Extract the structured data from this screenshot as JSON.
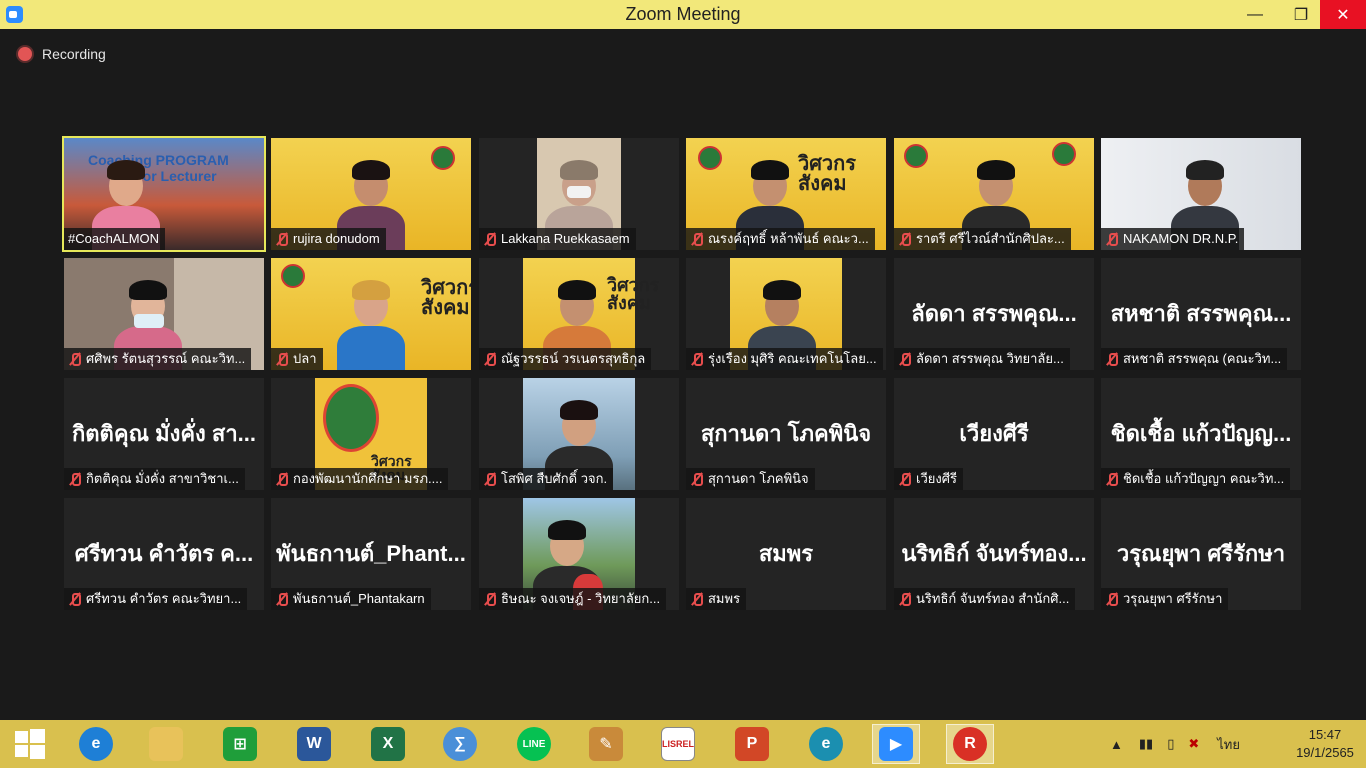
{
  "window": {
    "title": "Zoom Meeting"
  },
  "recording": {
    "label": "Recording"
  },
  "participants": [
    {
      "label": "#CoachALMON",
      "video": true,
      "active": true,
      "muted": false
    },
    {
      "label": "rujira donudom",
      "video": true,
      "muted": true
    },
    {
      "label": "Lakkana Ruekkasaem",
      "video": true,
      "muted": true
    },
    {
      "label": "ณรงค์ฤทธิ์ หล้าพันธ์ คณะว...",
      "video": true,
      "muted": true
    },
    {
      "label": "ราตรี   ศรีไวณ์สำนักศิปละ...",
      "video": true,
      "muted": true
    },
    {
      "label": "NAKAMON DR.N.P.",
      "video": true,
      "muted": true
    },
    {
      "label": "ศศิพร รัตนสุวรรณ์ คณะวิท...",
      "video": true,
      "muted": true
    },
    {
      "label": "ปลา",
      "video": true,
      "muted": true
    },
    {
      "label": "ณัฐวรรธน์ วรเนตรสุทธิกุล",
      "video": true,
      "muted": true
    },
    {
      "label": "รุ่งเรือง มุศิริ คณะเทคโนโลย...",
      "video": true,
      "muted": true
    },
    {
      "label": "ลัดดา สรรพคุณ  วิทยาลัย...",
      "big": "ลัดดา สรรพคุณ...",
      "video": false,
      "muted": true
    },
    {
      "label": "สหชาติ สรรพคุณ (คณะวิท...",
      "big": "สหชาติ สรรพคุณ...",
      "video": false,
      "muted": true
    },
    {
      "label": "กิตติคุณ  มั่งคั่ง สาขาวิชาเ...",
      "big": "กิตติคุณ  มั่งคั่ง สา...",
      "video": false,
      "muted": true
    },
    {
      "label": "กองพัฒนานักศึกษา มรภ....",
      "video": true,
      "muted": true
    },
    {
      "label": "โสพิศ สืบศักดิ์ วจก.",
      "video": true,
      "muted": true
    },
    {
      "label": "สุกานดา โภคพินิจ",
      "big": "สุกานดา โภคพินิจ",
      "video": false,
      "muted": true
    },
    {
      "label": "เวียงศีรี",
      "big": "เวียงศีรี",
      "video": false,
      "muted": true
    },
    {
      "label": "ชิดเชื้อ แก้วปัญญา คณะวิท...",
      "big": "ชิดเชื้อ แก้วปัญญ...",
      "video": false,
      "muted": true
    },
    {
      "label": "ศรีทวน  คำวัตร คณะวิทยา...",
      "big": "ศรีทวน  คำวัตร ค...",
      "video": false,
      "muted": true
    },
    {
      "label": "พันธกานต์_Phantakarn",
      "big": "พันธกานต์_Phant...",
      "video": false,
      "muted": true
    },
    {
      "label": "ธิษณะ จงเจษฎ์ - วิทยาลัยก...",
      "video": true,
      "muted": true
    },
    {
      "label": "สมพร",
      "big": "สมพร",
      "video": false,
      "muted": true
    },
    {
      "label": "นริทธิก์ จันทร์ทอง สำนักศิ...",
      "big": "นริทธิก์ จันทร์ทอง...",
      "video": false,
      "muted": true
    },
    {
      "label": "วรุณยุพา ศรีรักษา",
      "big": "วรุณยุพา ศรีรักษา",
      "video": false,
      "muted": true
    }
  ],
  "video_text": {
    "coach_banner": "Coaching PROGRAM",
    "coach_banner2": "for Lecturer",
    "banner_thai1": "วิศวกร",
    "banner_thai2": "สังคม"
  },
  "taskbar": {
    "apps": [
      {
        "name": "internet-explorer-icon",
        "glyph": "e",
        "color": "#1e7fd6"
      },
      {
        "name": "file-explorer-icon",
        "glyph": "",
        "color": "#e8c25a"
      },
      {
        "name": "store-icon",
        "glyph": "⊞",
        "color": "#1f9e3a"
      },
      {
        "name": "word-icon",
        "glyph": "W",
        "color": "#2b579a"
      },
      {
        "name": "excel-icon",
        "glyph": "X",
        "color": "#217346"
      },
      {
        "name": "math-input-icon",
        "glyph": "∑",
        "color": "#4a8fd8"
      },
      {
        "name": "line-icon",
        "glyph": "LINE",
        "color": "#06c152"
      },
      {
        "name": "paint-icon",
        "glyph": "✎",
        "color": "#c98a3a"
      },
      {
        "name": "lisrel-icon",
        "glyph": "LISREL",
        "color": "#ffffff"
      },
      {
        "name": "powerpoint-icon",
        "glyph": "P",
        "color": "#d24726"
      },
      {
        "name": "edge-icon",
        "glyph": "e",
        "color": "#1b8fb0"
      },
      {
        "name": "zoom-icon",
        "glyph": "▶",
        "color": "#2d8cff"
      },
      {
        "name": "chrome-icon",
        "glyph": "R",
        "color": "#d93025"
      }
    ],
    "language": "ไทย",
    "time": "15:47",
    "date": "19/1/2565"
  },
  "colors": {
    "titlebar": "#f2e87a",
    "taskbar": "#d9c04e",
    "active_speaker": "#e7e85a",
    "mute_red": "#e64d4d"
  }
}
